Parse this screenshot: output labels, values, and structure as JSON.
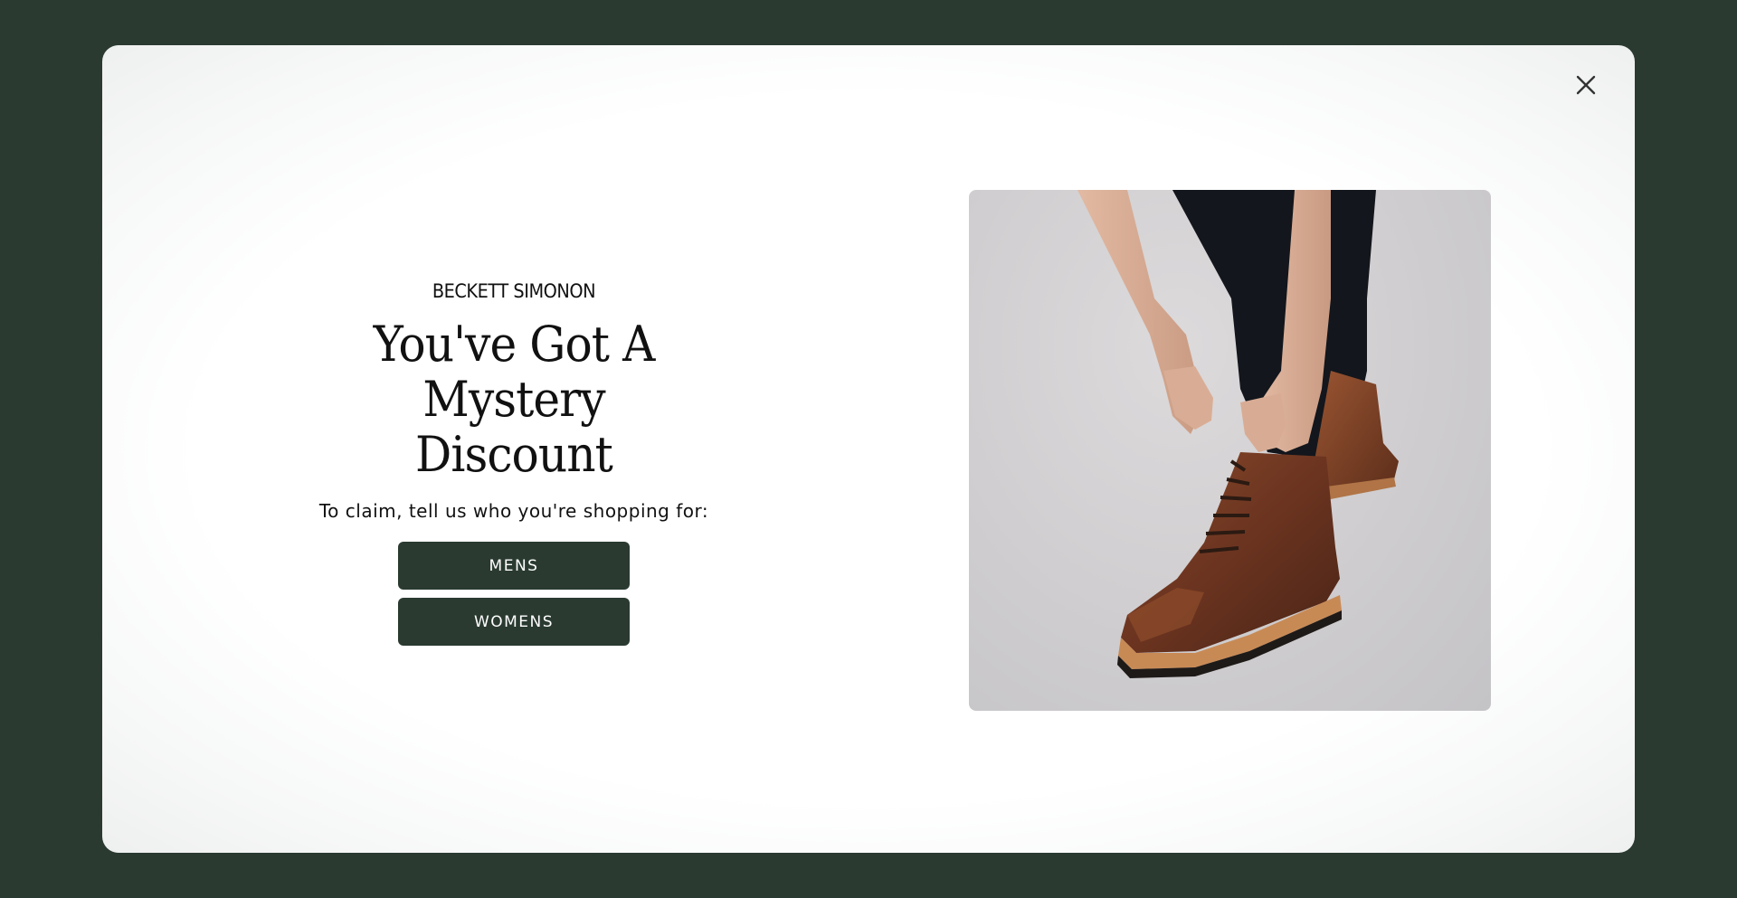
{
  "modal": {
    "brand": "BECKETT SIMONON",
    "headline_line1": "You've Got A",
    "headline_line2": "Mystery Discount",
    "subtext": "To claim, tell us who you're shopping for:",
    "buttons": {
      "mens": "MENS",
      "womens": "WOMENS"
    },
    "close_icon": "close-icon",
    "image": "product-photo-boots"
  },
  "colors": {
    "page_background": "#2a3a31",
    "button_background": "#2a3a31",
    "button_text": "#ffffff",
    "modal_background": "#ffffff"
  }
}
